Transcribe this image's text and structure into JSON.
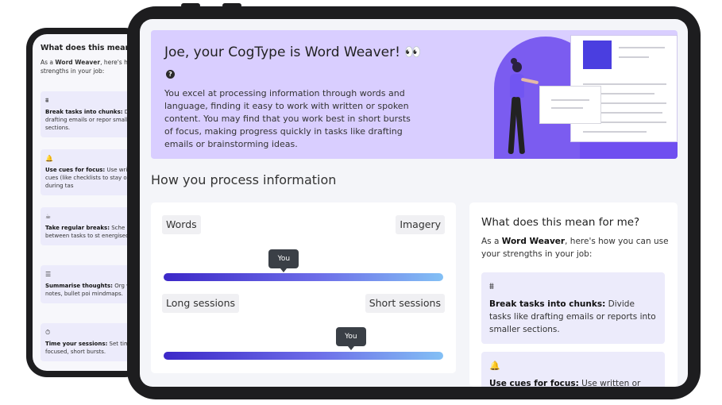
{
  "phone": {
    "title": "What does this mean f",
    "intro_prefix": "As a ",
    "intro_strong": "Word Weaver",
    "intro_suffix": ", here's ho your strengths in your job:",
    "tips": [
      {
        "icon": "⩩",
        "bold": "Break tasks into chunks:",
        "text": " D like drafting emails or repor smaller sections."
      },
      {
        "icon": "🔔",
        "bold": "Use cues for focus:",
        "text": " Use wri verbal cues (like checklists to stay on track during tas"
      },
      {
        "icon": "☕",
        "bold": "Take regular breaks:",
        "text": " Sche breaks between tasks to st energised."
      },
      {
        "icon": "☰",
        "bold": "Summarise thoughts:",
        "text": " Org with short notes, bullet poi mindmaps."
      },
      {
        "icon": "⏱",
        "bold": "Time your sessions:",
        "text": " Set tim in focused, short bursts."
      }
    ]
  },
  "hero": {
    "title": "Joe, your CogType is Word Weaver! 👀",
    "info_icon": "?",
    "body": "You excel at processing information through words and language, finding it easy to work with written or spoken content. You may find that you work best in short bursts of focus, making progress quickly in tasks like drafting emails or brainstorming ideas."
  },
  "section_title": "How you process information",
  "scales": [
    {
      "left_label": "Words",
      "right_label": "Imagery",
      "you_label": "You",
      "position": 0.43
    },
    {
      "left_label": "Long sessions",
      "right_label": "Short sessions",
      "you_label": "You",
      "position": 0.67
    }
  ],
  "meaning": {
    "title": "What does this mean for me?",
    "intro_prefix": "As a ",
    "intro_strong": "Word Weaver",
    "intro_suffix": ", here's how you can use your strengths in your job:",
    "tips": [
      {
        "icon": "⩩",
        "bold": "Break tasks into chunks:",
        "text": " Divide tasks like drafting emails or reports into smaller sections."
      },
      {
        "icon": "🔔",
        "bold": "Use cues for focus:",
        "text": " Use written or"
      }
    ]
  }
}
